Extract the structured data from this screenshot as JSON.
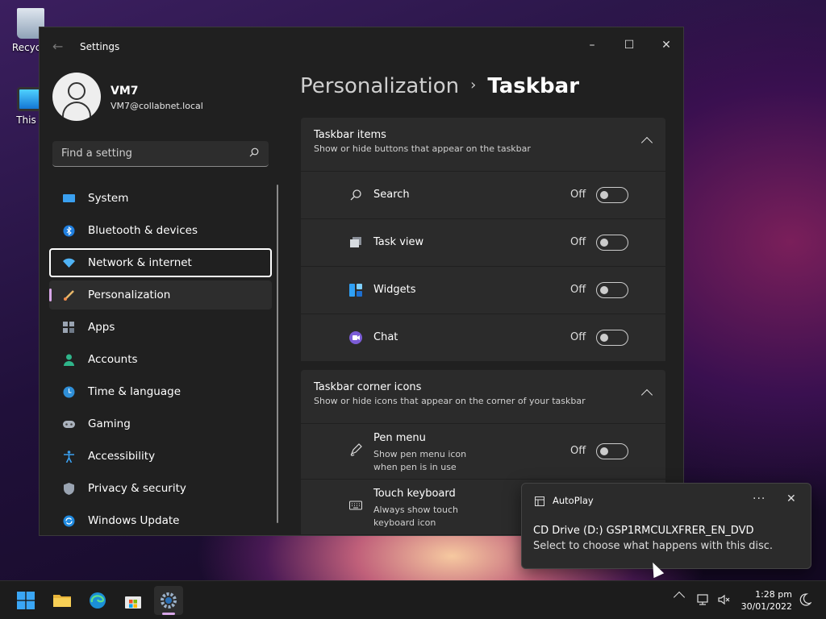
{
  "desktop": {
    "icons": [
      {
        "label": "Recycle"
      },
      {
        "label": "This P"
      }
    ]
  },
  "window": {
    "title": "Settings",
    "controls": {
      "minimize": "–",
      "maximize": "☐",
      "close": "✕"
    }
  },
  "profile": {
    "name": "VM7",
    "email": "VM7@collabnet.local"
  },
  "search": {
    "placeholder": "Find a setting"
  },
  "nav": {
    "items": [
      {
        "label": "System",
        "icon": "monitor-icon"
      },
      {
        "label": "Bluetooth & devices",
        "icon": "bluetooth-icon"
      },
      {
        "label": "Network & internet",
        "icon": "wifi-icon"
      },
      {
        "label": "Personalization",
        "icon": "brush-icon"
      },
      {
        "label": "Apps",
        "icon": "apps-icon"
      },
      {
        "label": "Accounts",
        "icon": "person-icon"
      },
      {
        "label": "Time & language",
        "icon": "globe-clock-icon"
      },
      {
        "label": "Gaming",
        "icon": "gamepad-icon"
      },
      {
        "label": "Accessibility",
        "icon": "accessibility-icon"
      },
      {
        "label": "Privacy & security",
        "icon": "shield-icon"
      },
      {
        "label": "Windows Update",
        "icon": "update-icon"
      }
    ]
  },
  "breadcrumb": {
    "parent": "Personalization",
    "separator": "›",
    "current": "Taskbar"
  },
  "taskbar_items": {
    "title": "Taskbar items",
    "subtitle": "Show or hide buttons that appear on the taskbar",
    "rows": [
      {
        "label": "Search",
        "state": "Off"
      },
      {
        "label": "Task view",
        "state": "Off"
      },
      {
        "label": "Widgets",
        "state": "Off"
      },
      {
        "label": "Chat",
        "state": "Off"
      }
    ]
  },
  "corner_icons": {
    "title": "Taskbar corner icons",
    "subtitle": "Show or hide icons that appear on the corner of your taskbar",
    "rows": [
      {
        "label": "Pen menu",
        "sub": "Show pen menu icon when pen is in use",
        "state": "Off"
      },
      {
        "label": "Touch keyboard",
        "sub": "Always show touch keyboard icon",
        "state": ""
      }
    ]
  },
  "toast": {
    "app": "AutoPlay",
    "more": "···",
    "close": "✕",
    "title": "CD Drive (D:) GSP1RMCULXFRER_EN_DVD",
    "body": "Select to choose what happens with this disc."
  },
  "clock": {
    "time": "1:28 pm",
    "date": "30/01/2022"
  },
  "colors": {
    "accent": "#d8a7e8",
    "focus": "#ffffff"
  }
}
